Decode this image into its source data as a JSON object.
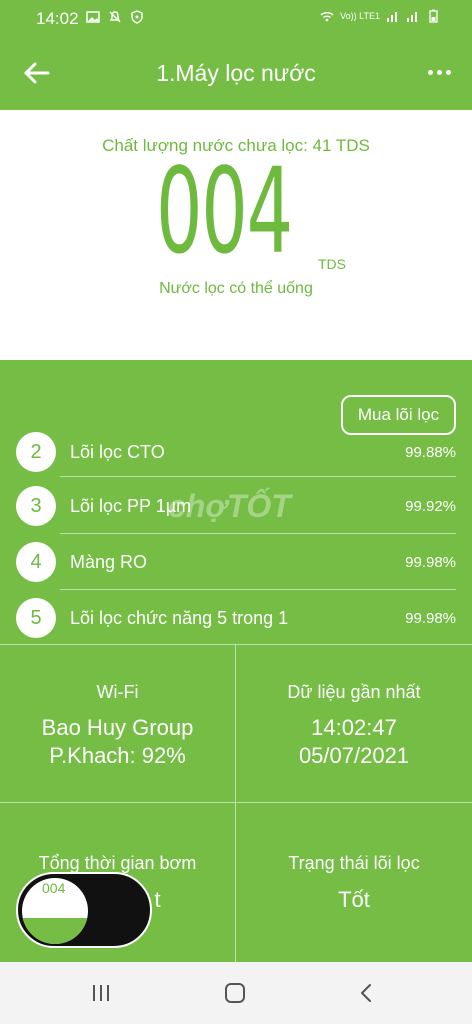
{
  "status_bar": {
    "time": "14:02",
    "left_icons": [
      "image-icon",
      "mute-icon",
      "shield-icon"
    ],
    "network_label": "Vo)) LTE1",
    "right_icons": [
      "wifi-icon",
      "signal-icon",
      "signal-icon",
      "battery-icon"
    ]
  },
  "header": {
    "title": "1.Máy lọc nước",
    "back_icon": "arrow-left-icon",
    "more_icon": "more-dots-icon"
  },
  "quality": {
    "unfiltered_label": "Chất lượng nước chưa lọc: 41 TDS",
    "tds_value": "004",
    "tds_unit": "TDS",
    "status_text": "Nước lọc có thể uống"
  },
  "buy_button": "Mua lõi lọc",
  "filters": [
    {
      "number": "2",
      "name": "Lõi lọc CTO",
      "percent": "99.88%"
    },
    {
      "number": "3",
      "name": "Lõi lọc PP 1µm",
      "percent": "99.92%"
    },
    {
      "number": "4",
      "name": "Màng RO",
      "percent": "99.98%"
    },
    {
      "number": "5",
      "name": "Lõi lọc chức năng 5 trong 1",
      "percent": "99.98%"
    }
  ],
  "watermark": "chợTỐT",
  "info": {
    "wifi_label": "Wi-Fi",
    "wifi_name": "Bao Huy Group",
    "wifi_signal": "P.Khach: 92%",
    "latest_label": "Dữ liệu gần nhất",
    "latest_time": "14:02:47",
    "latest_date": "05/07/2021",
    "pump_label": "Tổng thời gian bơm",
    "pump_value": "t",
    "filter_state_label": "Trạng thái lõi lọc",
    "filter_state_value": "Tốt"
  },
  "pip": {
    "value": "004"
  },
  "nav": {
    "icons": [
      "recent-apps-icon",
      "home-icon",
      "back-icon"
    ]
  },
  "colors": {
    "primary": "#75bd45",
    "accent_text": "#6dba3f",
    "surface": "#ffffff",
    "nav_bar": "#f3f3f3"
  }
}
